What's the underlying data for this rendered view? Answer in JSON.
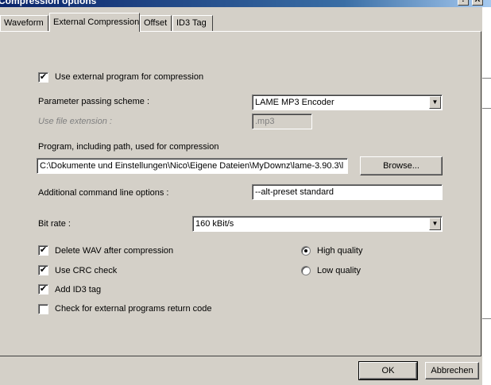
{
  "window": {
    "title": "Compression options"
  },
  "titlebar_buttons": {
    "help": "?",
    "close": "X"
  },
  "tabs": [
    {
      "label": "Waveform"
    },
    {
      "label": "External Compression"
    },
    {
      "label": "Offset"
    },
    {
      "label": "ID3 Tag"
    }
  ],
  "external": {
    "use_external_label": "Use external program for compression",
    "use_external_checked": true,
    "scheme_label": "Parameter passing scheme :",
    "scheme_value": "LAME MP3 Encoder",
    "extension_label": "Use file extension :",
    "extension_value": ".mp3",
    "program_label": "Program, including path, used for compression",
    "program_value": "C:\\Dokumente und Einstellungen\\Nico\\Eigene Dateien\\MyDownz\\lame-3.90.3\\l",
    "browse_label": "Browse...",
    "cmdline_label": "Additional command line options :",
    "cmdline_value": "--alt-preset standard",
    "bitrate_label": "Bit rate :",
    "bitrate_value": "160 kBit/s",
    "delete_wav_label": "Delete WAV after compression",
    "delete_wav_checked": true,
    "crc_label": "Use CRC check",
    "crc_checked": true,
    "id3_label": "Add ID3 tag",
    "id3_checked": true,
    "return_code_label": "Check for external programs return code",
    "return_code_checked": false,
    "high_quality_label": "High quality",
    "low_quality_label": "Low quality",
    "quality_selected": "high"
  },
  "footer": {
    "ok_label": "OK",
    "cancel_label": "Abbrechen"
  },
  "glyphs": {
    "check": "✔",
    "dropdown": "▼"
  }
}
